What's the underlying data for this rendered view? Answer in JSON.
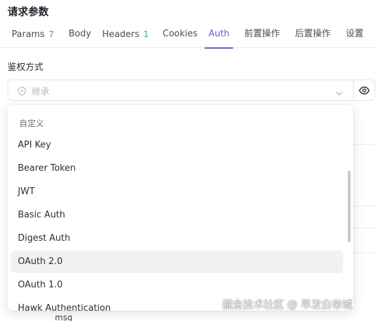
{
  "section": {
    "title": "请求参数"
  },
  "tabs": [
    {
      "label": "Params",
      "count": "7"
    },
    {
      "label": "Body",
      "count": ""
    },
    {
      "label": "Headers",
      "count": "1"
    },
    {
      "label": "Cookies",
      "count": ""
    },
    {
      "label": "Auth",
      "count": "",
      "active": true
    },
    {
      "label": "前置操作",
      "count": ""
    },
    {
      "label": "后置操作",
      "count": ""
    },
    {
      "label": "设置",
      "count": ""
    }
  ],
  "auth": {
    "label": "鉴权方式",
    "select_value": "继承",
    "dropdown": {
      "group_label": "自定义",
      "options": [
        "API Key",
        "Bearer Token",
        "JWT",
        "Basic Auth",
        "Digest Auth",
        "OAuth 2.0",
        "OAuth 1.0",
        "Hawk Authentication"
      ],
      "highlighted": "OAuth 2.0"
    }
  },
  "background": {
    "cell_text": "msg"
  },
  "watermark": "掘金技术社区 @ 早发白帝城",
  "colors": {
    "accent": "#6b57d6",
    "count": "#2ea58a",
    "highlight_bg": "#f1f1f3"
  },
  "icons": {
    "select": "shield-icon",
    "dropdown": "chevron-down-icon",
    "visibility": "eye-icon"
  }
}
